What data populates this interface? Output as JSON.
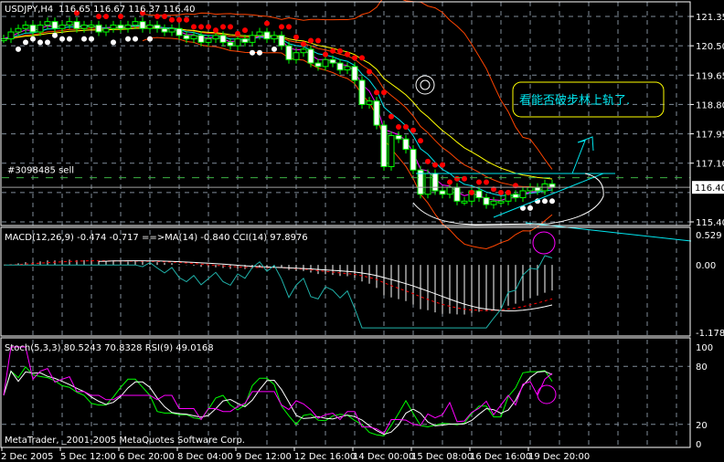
{
  "header": {
    "symbol_label": "USDJPY,H4",
    "ohlc_label": "116.65 116.67 116.37 116.40"
  },
  "order_label": "#3098485 sell",
  "annotation_text": "看能否破步林上轨了.",
  "copyright": "MetaTrader, _2001-2005 MetaQuotes Software Corp.",
  "macd_label": "MACD(12,26,9) -0.474 -0.717 ==>MA(14) -0.840  CCI(14) 97.8976",
  "stoch_label": "Stoch(5,3,3) 80.5243 70.8328  RSI(9) 49.0168",
  "colors": {
    "bg": "#000000",
    "grid": "#7f8c99",
    "bull": "#00ff00",
    "candle_body": "#ffffff",
    "ma_fast": "#ff00ff",
    "ma_mid": "#00e5ee",
    "ma_slow": "#ffff00",
    "bands": "#ff4500",
    "sar": "#ff0000",
    "annotation": "#00e5ee",
    "box": "#ffff00"
  },
  "chart_data": [
    {
      "type": "candlestick",
      "title": "USDJPY,H4",
      "ylim": [
        115.4,
        121.35
      ],
      "yticks": [
        "121.35",
        "120.50",
        "119.65",
        "118.80",
        "117.95",
        "117.10",
        "115.40"
      ],
      "current_price": "116.40",
      "order_price": 116.68,
      "xticks": [
        "2 Dec 2005",
        "5 Dec 12:00",
        "6 Dec 20:00",
        "8 Dec 04:00",
        "9 Dec 12:00",
        "12 Dec 16:00",
        "14 Dec 00:00",
        "15 Dec 08:00",
        "16 Dec 16:00",
        "19 Dec 20:00"
      ],
      "closes": [
        120.7,
        120.9,
        121.0,
        121.1,
        120.9,
        121.1,
        121.2,
        121.0,
        121.1,
        121.2,
        121.0,
        121.1,
        121.1,
        120.9,
        121.0,
        121.1,
        121.0,
        121.1,
        121.2,
        121.0,
        121.1,
        121.0,
        120.9,
        121.0,
        120.8,
        120.7,
        120.8,
        120.6,
        120.7,
        120.8,
        120.6,
        120.5,
        120.7,
        120.6,
        120.8,
        120.9,
        120.7,
        120.8,
        120.5,
        120.1,
        120.3,
        120.4,
        120.0,
        119.9,
        120.1,
        120.0,
        119.8,
        119.9,
        119.5,
        118.8,
        118.9,
        118.2,
        117.0,
        117.9,
        117.8,
        117.5,
        116.9,
        116.2,
        116.8,
        116.3,
        116.2,
        116.4,
        116.0,
        116.0,
        116.3,
        116.1,
        115.9,
        116.0,
        116.0,
        116.2,
        116.1,
        116.3,
        116.4,
        116.3,
        116.5,
        116.4
      ]
    },
    {
      "type": "line",
      "title": "MACD / CCI",
      "ylim": [
        -1.178,
        0.529
      ],
      "yticks": [
        "0.529",
        "0.00",
        "-1.178"
      ]
    },
    {
      "type": "line",
      "title": "Stoch / RSI",
      "ylim": [
        0,
        100
      ],
      "yticks": [
        "100",
        "80",
        "20",
        "0"
      ]
    }
  ]
}
